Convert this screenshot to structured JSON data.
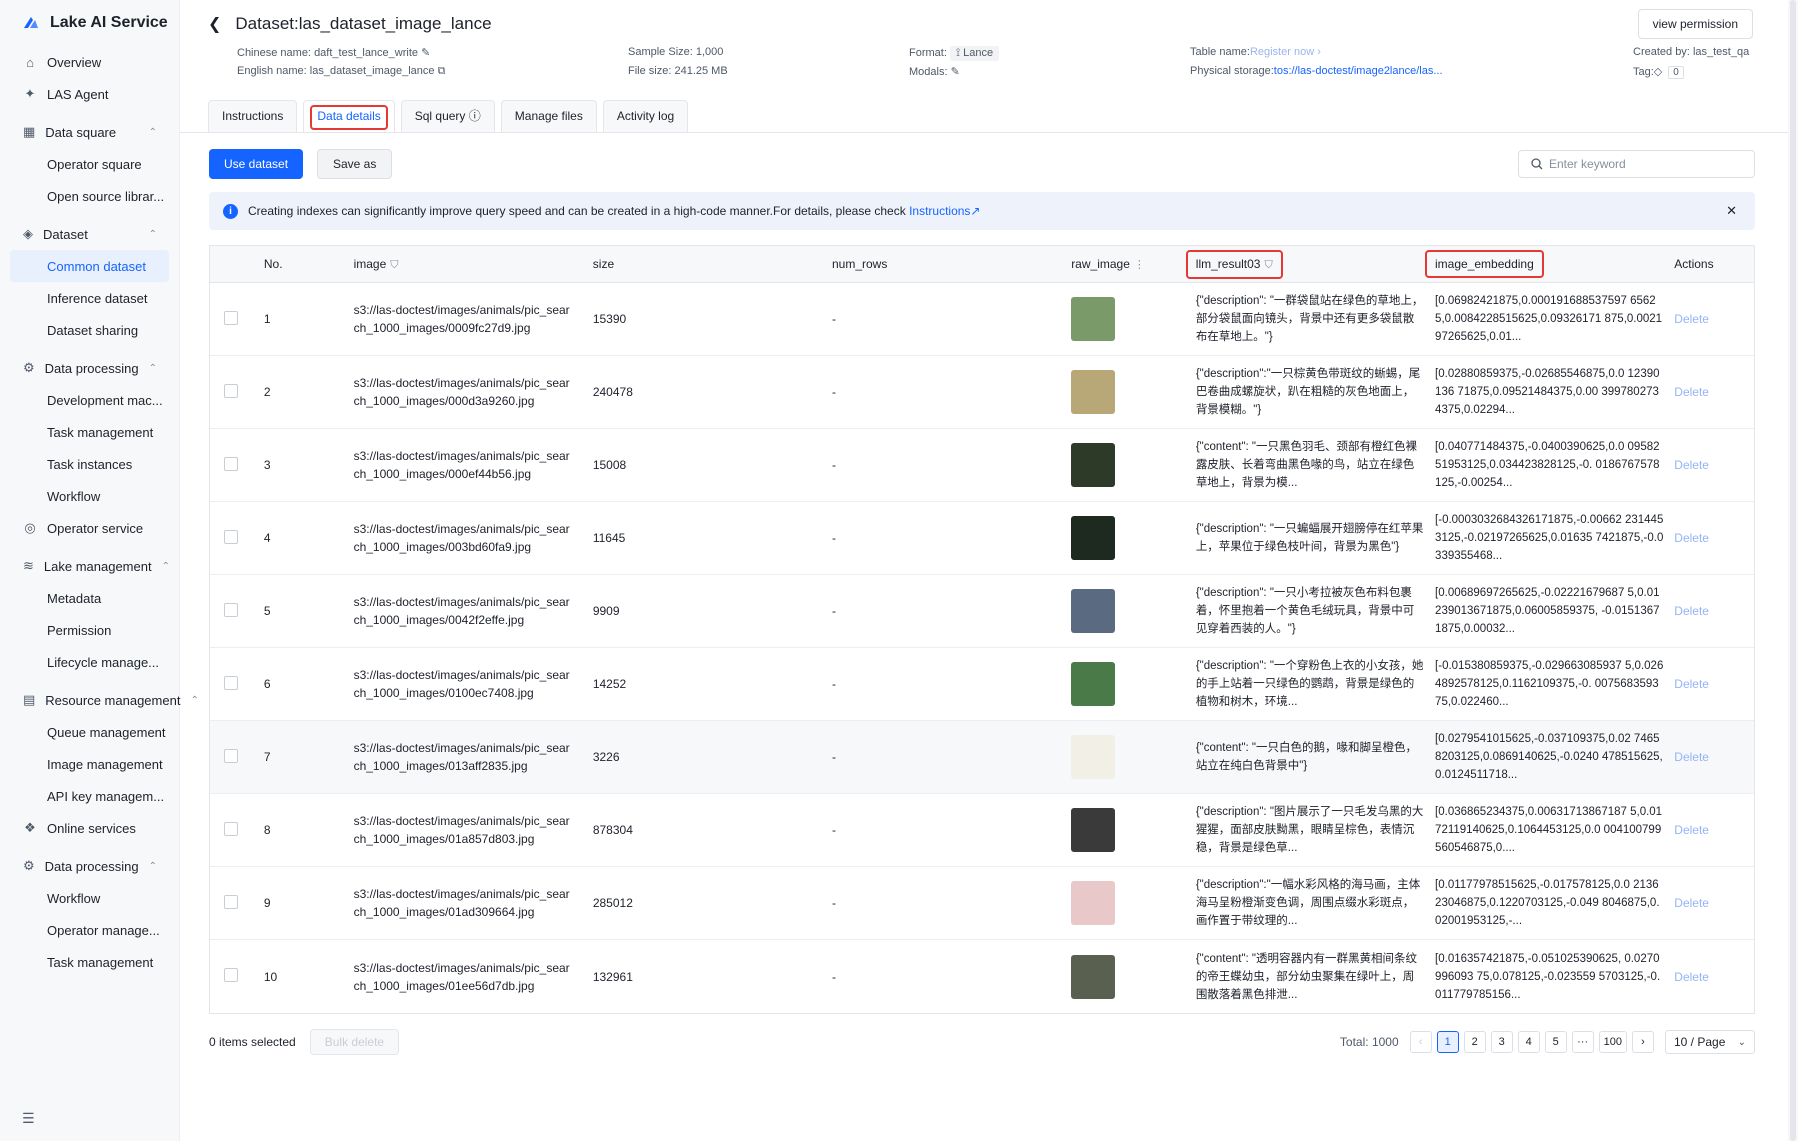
{
  "brand": {
    "name": "Lake AI Service"
  },
  "sidebar": {
    "top": [
      {
        "label": "Overview",
        "icon": "overview-icon"
      },
      {
        "label": "LAS Agent",
        "icon": "agent-icon"
      }
    ],
    "groups": [
      {
        "label": "Data square",
        "items": [
          "Operator square",
          "Open source librar..."
        ]
      },
      {
        "label": "Dataset",
        "items": [
          "Common dataset",
          "Inference dataset",
          "Dataset sharing"
        ]
      },
      {
        "label": "Data processing",
        "items": [
          "Development mac...",
          "Task management",
          "Task instances",
          "Workflow"
        ]
      }
    ],
    "operator_service": "Operator service",
    "groups2": [
      {
        "label": "Lake management",
        "items": [
          "Metadata",
          "Permission",
          "Lifecycle manage..."
        ]
      },
      {
        "label": "Resource management",
        "items": [
          "Queue management",
          "Image management",
          "API key managem..."
        ]
      }
    ],
    "online_services": "Online services",
    "groups3": [
      {
        "label": "Data processing",
        "items": [
          "Workflow",
          "Operator manage...",
          "Task management"
        ]
      }
    ]
  },
  "header": {
    "title": "Dataset:las_dataset_image_lance",
    "view_permission": "view permission"
  },
  "meta": {
    "chinese_name_label": "Chinese name:",
    "chinese_name": "daft_test_lance_write",
    "english_name_label": "English name:",
    "english_name": "las_dataset_image_lance",
    "sample_size_label": "Sample Size:",
    "sample_size": "1,000",
    "file_size_label": "File size:",
    "file_size": "241.25 MB",
    "format_label": "Format:",
    "format": "Lance",
    "modals_label": "Modals:",
    "table_name_label": "Table name:",
    "table_name": "Register now",
    "physical_storage_label": "Physical storage:",
    "physical_storage": "tos://las-doctest/image2lance/las...",
    "created_by_label": "Created by:",
    "created_by": "las_test_qa",
    "tag_label": "Tag:",
    "tag_count": "0"
  },
  "tabs": [
    "Instructions",
    "Data details",
    "Sql query",
    "Manage files",
    "Activity log"
  ],
  "toolbar": {
    "use_dataset": "Use dataset",
    "save_as": "Save as",
    "search_placeholder": "Enter keyword"
  },
  "notice": {
    "text": "Creating indexes can significantly improve query speed and can be created in a high-code manner.For details, please check ",
    "link": "Instructions"
  },
  "table": {
    "columns": [
      "No.",
      "image",
      "size",
      "num_rows",
      "raw_image",
      "llm_result03",
      "image_embedding",
      "Actions"
    ],
    "rows": [
      {
        "no": "1",
        "image": "s3://las-doctest/images/animals/pic_search_1000_images/0009fc27d9.jpg",
        "size": "15390",
        "num_rows": "-",
        "llm": "{\"description\": \"一群袋鼠站在绿色的草地上，部分袋鼠面向镜头，背景中还有更多袋鼠散布在草地上。\"}",
        "emb": "[0.06982421875,0.000191688537597 65625,0.0084228515625,0.09326171 875,0.002197265625,0.01...",
        "action": "Delete",
        "thumb": "#7a9a6a"
      },
      {
        "no": "2",
        "image": "s3://las-doctest/images/animals/pic_search_1000_images/000d3a9260.jpg",
        "size": "240478",
        "num_rows": "-",
        "llm": "{\"description\":\"一只棕黄色带斑纹的蜥蜴，尾巴卷曲成螺旋状，趴在粗糙的灰色地面上，背景模糊。\"}",
        "emb": "[0.02880859375,-0.02685546875,0.0 12390136 71875,0.09521484375,0.00 3997802734375,0.02294...",
        "action": "Delete",
        "thumb": "#b8a878"
      },
      {
        "no": "3",
        "image": "s3://las-doctest/images/animals/pic_search_1000_images/000ef44b56.jpg",
        "size": "15008",
        "num_rows": "-",
        "llm": "{\"content\": \"一只黑色羽毛、颈部有橙红色裸露皮肤、长着弯曲黑色喙的鸟，站立在绿色草地上，背景为模...",
        "emb": "[0.040771484375,-0.0400390625,0.0 0958251953125,0.034423828125,-0. 0186767578125,-0.00254...",
        "action": "Delete",
        "thumb": "#2e3a28"
      },
      {
        "no": "4",
        "image": "s3://las-doctest/images/animals/pic_search_1000_images/003bd60fa9.jpg",
        "size": "11645",
        "num_rows": "-",
        "llm": "{\"description\": \"一只蝙蝠展开翅膀停在红苹果上，苹果位于绿色枝叶间，背景为黑色\"}",
        "emb": "[-0.0003032684326171875,-0.00662 2314453125,-0.02197265625,0.01635 7421875,-0.0339355468...",
        "action": "Delete",
        "thumb": "#1e2a20"
      },
      {
        "no": "5",
        "image": "s3://las-doctest/images/animals/pic_search_1000_images/0042f2effe.jpg",
        "size": "9909",
        "num_rows": "-",
        "llm": "{\"description\": \"一只小考拉被灰色布料包裹着，怀里抱着一个黄色毛绒玩具，背景中可见穿着西装的人。\"}",
        "emb": "[0.00689697265625,-0.02221679687 5,0.01239013671875,0.06005859375, -0.01513671875,0.00032...",
        "action": "Delete",
        "thumb": "#5a6a80"
      },
      {
        "no": "6",
        "image": "s3://las-doctest/images/animals/pic_search_1000_images/0100ec7408.jpg",
        "size": "14252",
        "num_rows": "-",
        "llm": "{\"description\": \"一个穿粉色上衣的小女孩，她的手上站着一只绿色的鹦鹉，背景是绿色的植物和树木，环境...",
        "emb": "[-0.015380859375,-0.029663085937 5,0.0264892578125,0.1162109375,-0. 007568359375,0.022460...",
        "action": "Delete",
        "thumb": "#4a7a48"
      },
      {
        "no": "7",
        "image": "s3://las-doctest/images/animals/pic_search_1000_images/013aff2835.jpg",
        "size": "3226",
        "num_rows": "-",
        "llm": "{\"content\": \"一只白色的鹅，喙和脚呈橙色，站立在纯白色背景中\"}",
        "emb": "[0.0279541015625,-0.037109375,0.02 74658203125,0.0869140625,-0.0240 478515625,0.0124511718...",
        "action": "Delete",
        "thumb": "#f2efe6"
      },
      {
        "no": "8",
        "image": "s3://las-doctest/images/animals/pic_search_1000_images/01a857d803.jpg",
        "size": "878304",
        "num_rows": "-",
        "llm": "{\"description\": \"图片展示了一只毛发乌黑的大猩猩，面部皮肤黝黑，眼睛呈棕色，表情沉稳，背景是绿色草...",
        "emb": "[0.036865234375,0.00631713867187 5,0.0172119140625,0.1064453125,0.0 004100799560546875,0....",
        "action": "Delete",
        "thumb": "#3a3a3a"
      },
      {
        "no": "9",
        "image": "s3://las-doctest/images/animals/pic_search_1000_images/01ad309664.jpg",
        "size": "285012",
        "num_rows": "-",
        "llm": "{\"description\":\"一幅水彩风格的海马画，主体海马呈粉橙渐变色调，周围点缀水彩斑点，画作置于带纹理的...",
        "emb": "[0.01177978515625,-0.017578125,0.0 213623046875,0.1220703125,-0.049 8046875,0.02001953125,-...",
        "action": "Delete",
        "thumb": "#e8c8c8"
      },
      {
        "no": "10",
        "image": "s3://las-doctest/images/animals/pic_search_1000_images/01ee56d7db.jpg",
        "size": "132961",
        "num_rows": "-",
        "llm": "{\"content\": \"透明容器内有一群黑黄相间条纹的帝王蝶幼虫，部分幼虫聚集在绿叶上，周围散落着黑色排泄...",
        "emb": "[0.016357421875,-0.051025390625, 0.0270996093 75,0.078125,-0.023559 5703125,-0.011779785156...",
        "action": "Delete",
        "thumb": "#5a6050"
      }
    ]
  },
  "footer": {
    "selected": "0 items selected",
    "bulk_delete": "Bulk delete",
    "total": "Total: 1000",
    "pages": [
      "1",
      "2",
      "3",
      "4",
      "5",
      "···",
      "100"
    ],
    "page_size": "10  / Page"
  }
}
